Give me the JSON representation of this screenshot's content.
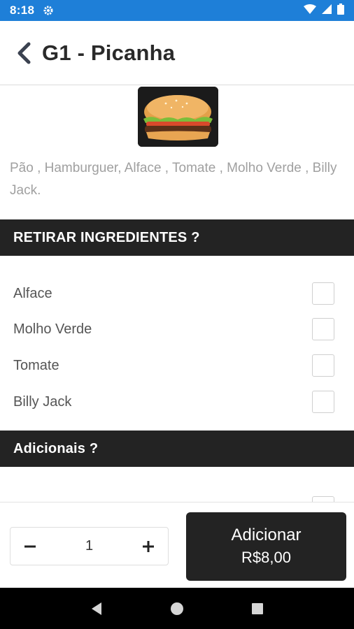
{
  "status_bar": {
    "time": "8:18",
    "icons": [
      "gear-icon",
      "wifi-icon",
      "signal-icon",
      "battery-icon"
    ],
    "color": "#1e7fd8"
  },
  "header": {
    "title": "G1 - Picanha",
    "back_icon": "chevron-left-icon"
  },
  "product": {
    "image": "burger-image",
    "description": "Pão , Hamburguer, Alface , Tomate , Molho Verde , Billy Jack."
  },
  "remove_section": {
    "title": "RETIRAR INGREDIENTES ?",
    "items": [
      {
        "label": "Alface",
        "checked": false
      },
      {
        "label": "Molho Verde",
        "checked": false
      },
      {
        "label": "Tomate",
        "checked": false
      },
      {
        "label": "Billy Jack",
        "checked": false
      }
    ]
  },
  "extras_section": {
    "title": "Adicionais ?"
  },
  "order": {
    "quantity": "1",
    "minus_icon": "minus-icon",
    "plus_icon": "plus-icon",
    "add_label": "Adicionar",
    "price": "R$8,00"
  },
  "colors": {
    "dark_bar": "#232323",
    "description_text": "#a0a0a0"
  }
}
